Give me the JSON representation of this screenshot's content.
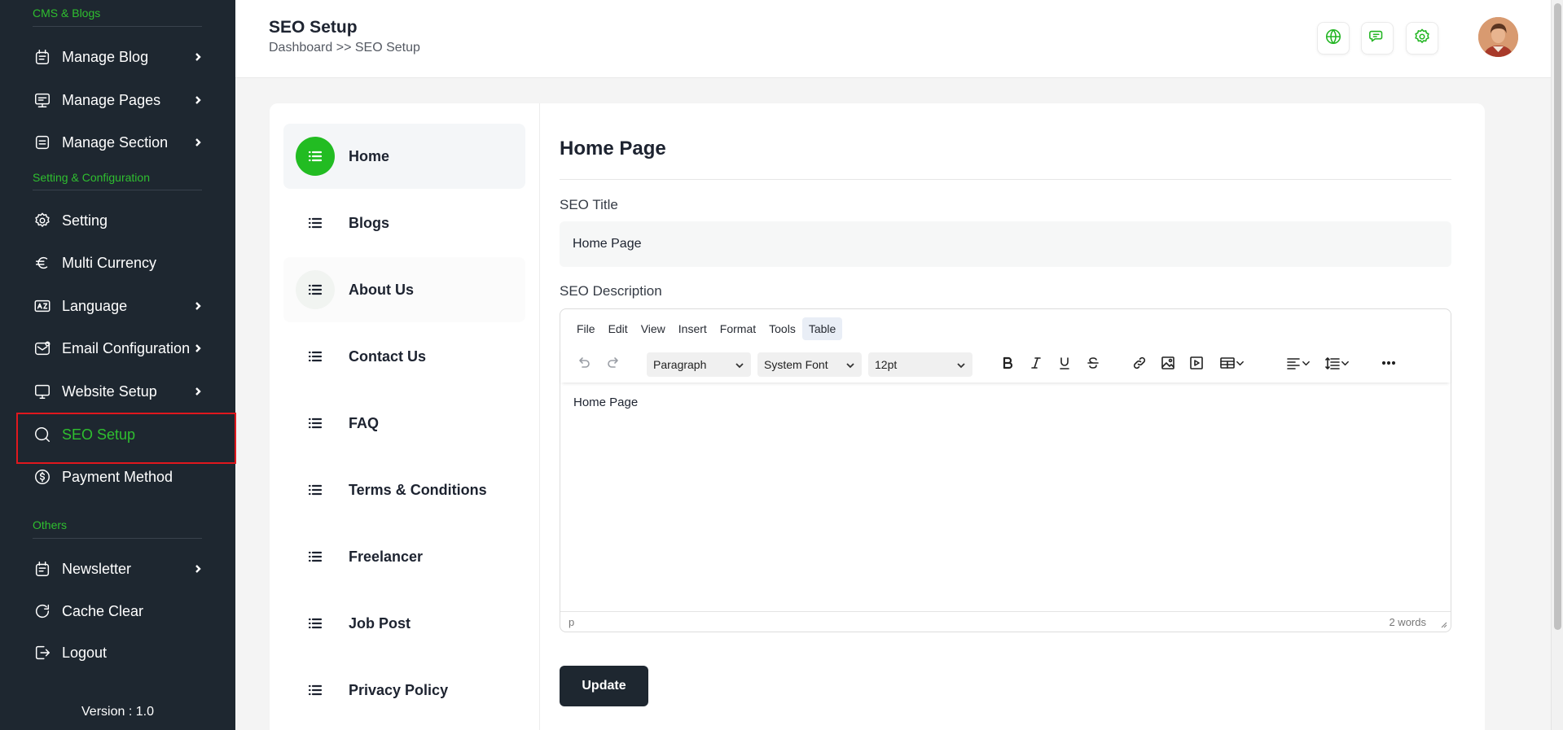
{
  "sidebar": {
    "section_cms": "CMS & Blogs",
    "section_setting": "Setting & Configuration",
    "section_others": "Others",
    "items": [
      {
        "label": "Manage Blog",
        "icon": "blog-icon"
      },
      {
        "label": "Manage Pages",
        "icon": "pages-icon"
      },
      {
        "label": "Manage Section",
        "icon": "section-icon"
      },
      {
        "label": "Setting",
        "icon": "gear-icon"
      },
      {
        "label": "Multi Currency",
        "icon": "euro-icon"
      },
      {
        "label": "Language",
        "icon": "language-icon"
      },
      {
        "label": "Email Configuration",
        "icon": "email-icon"
      },
      {
        "label": "Website Setup",
        "icon": "monitor-icon"
      },
      {
        "label": "SEO Setup",
        "icon": "search-icon"
      },
      {
        "label": "Payment Method",
        "icon": "dollar-icon"
      },
      {
        "label": "Newsletter",
        "icon": "newsletter-icon"
      },
      {
        "label": "Cache Clear",
        "icon": "refresh-icon"
      },
      {
        "label": "Logout",
        "icon": "logout-icon"
      }
    ],
    "version": "Version : 1.0"
  },
  "header": {
    "title": "SEO Setup",
    "breadcrumb": "Dashboard >> SEO Setup",
    "icons": [
      "globe-icon",
      "chat-icon",
      "gear-icon"
    ]
  },
  "tabs": [
    {
      "label": "Home"
    },
    {
      "label": "Blogs"
    },
    {
      "label": "About Us"
    },
    {
      "label": "Contact Us"
    },
    {
      "label": "FAQ"
    },
    {
      "label": "Terms & Conditions"
    },
    {
      "label": "Freelancer"
    },
    {
      "label": "Job Post"
    },
    {
      "label": "Privacy Policy"
    }
  ],
  "form": {
    "title": "Home Page",
    "seo_title_label": "SEO Title",
    "seo_title_value": "Home Page",
    "seo_description_label": "SEO Description",
    "update_label": "Update"
  },
  "editor": {
    "menu": [
      "File",
      "Edit",
      "View",
      "Insert",
      "Format",
      "Tools",
      "Table"
    ],
    "block_format": "Paragraph",
    "font_family": "System Font",
    "font_size": "12pt",
    "content": "Home Page",
    "path": "p",
    "word_count": "2 words"
  },
  "colors": {
    "accent": "#22bc22",
    "sidebar_bg": "#1e2730",
    "active_outline": "#e0181e"
  }
}
